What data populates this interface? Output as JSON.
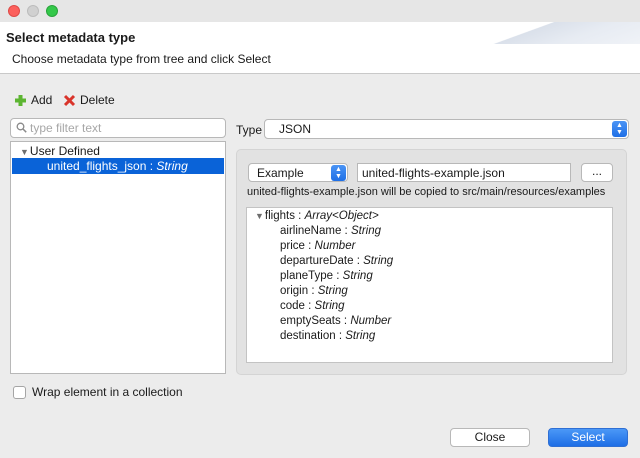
{
  "window": {
    "title": "Select metadata type",
    "subtitle": "Choose metadata type from tree and click Select"
  },
  "toolbar": {
    "add_label": "Add",
    "delete_label": "Delete"
  },
  "filter": {
    "placeholder": "type filter text",
    "value": ""
  },
  "tree": {
    "group_label": "User Defined",
    "selected_item": {
      "name": "united_flights_json",
      "separator": " : ",
      "type": "String"
    }
  },
  "wrap_checkbox": {
    "label": "Wrap element in a collection",
    "checked": false
  },
  "type_field": {
    "label": "Type",
    "value": "JSON"
  },
  "example": {
    "mode": "Example",
    "file_name": "united-flights-example.json",
    "browse_label": "...",
    "copy_note": "united-flights-example.json will be copied to src/main/resources/examples"
  },
  "structure": {
    "root": {
      "name": "flights",
      "type": "Array<Object>"
    },
    "fields": [
      {
        "name": "airlineName",
        "type": "String"
      },
      {
        "name": "price",
        "type": "Number"
      },
      {
        "name": "departureDate",
        "type": "String"
      },
      {
        "name": "planeType",
        "type": "String"
      },
      {
        "name": "origin",
        "type": "String"
      },
      {
        "name": "code",
        "type": "String"
      },
      {
        "name": "emptySeats",
        "type": "Number"
      },
      {
        "name": "destination",
        "type": "String"
      }
    ]
  },
  "buttons": {
    "close_label": "Close",
    "select_label": "Select"
  },
  "colors": {
    "accent": "#0a63d8",
    "add_icon": "#5cb531",
    "delete_icon": "#d9342b"
  },
  "icons": {
    "add": "plus-icon",
    "delete": "delete-x-icon",
    "search": "search-icon"
  }
}
